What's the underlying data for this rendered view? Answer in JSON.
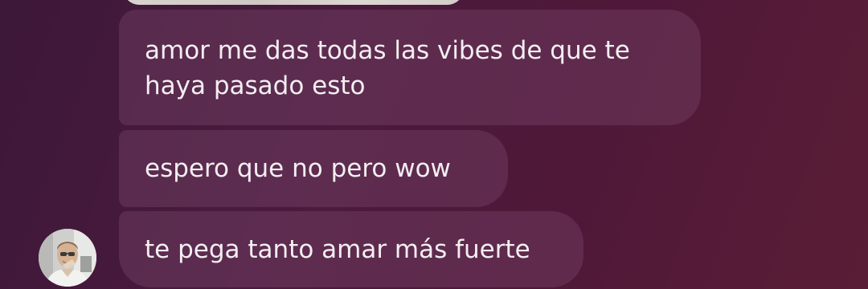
{
  "messages": [
    {
      "text_line_1": "amor me das todas las vibes de que te",
      "text_line_2": "haya pasado esto"
    },
    {
      "text": "espero que no pero wow"
    },
    {
      "text": "te pega tanto amar más fuerte"
    }
  ],
  "colors": {
    "background": "#4a1a3e",
    "bubble": "#6b3a5d",
    "text": "#f4eef2"
  }
}
